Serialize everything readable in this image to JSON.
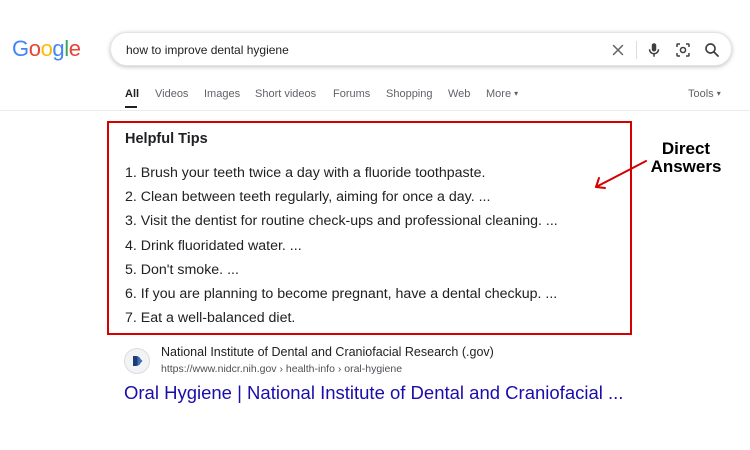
{
  "logo": {
    "letters": [
      "G",
      "o",
      "o",
      "g",
      "l",
      "e"
    ],
    "colors": [
      "#4285F4",
      "#EA4335",
      "#FBBC05",
      "#4285F4",
      "#34A853",
      "#EA4335"
    ]
  },
  "search": {
    "query": "how to improve dental hygiene",
    "icons": [
      "close-icon",
      "microphone-icon",
      "lens-icon",
      "search-icon"
    ]
  },
  "tabs": {
    "items": [
      "All",
      "Videos",
      "Images",
      "Short videos",
      "Forums",
      "Shopping",
      "Web",
      "More"
    ],
    "more_caret": "▾",
    "tools": "Tools",
    "tools_caret": "▾",
    "active": "All"
  },
  "snippet": {
    "title": "Helpful Tips",
    "tips": [
      "1. Brush your teeth twice a day with a fluoride toothpaste.",
      "2. Clean between teeth regularly, aiming for once a day. ...",
      "3. Visit the dentist for routine check-ups and professional cleaning. ...",
      "4. Drink fluoridated water. ...",
      "5. Don't smoke. ...",
      "6. If you are planning to become pregnant, have a dental checkup. ...",
      "7. Eat a well-balanced diet."
    ],
    "border_color": "#d60000"
  },
  "annotation": {
    "line1": "Direct",
    "line2": "Answers"
  },
  "result": {
    "favicon": "nidcr-favicon-icon",
    "site_name": "National Institute of Dental and Craniofacial Research (.gov)",
    "url": "https://www.nidcr.nih.gov › health-info › oral-hygiene",
    "title": "Oral Hygiene | National Institute of Dental and Craniofacial ...",
    "title_color": "#1a0dab"
  }
}
